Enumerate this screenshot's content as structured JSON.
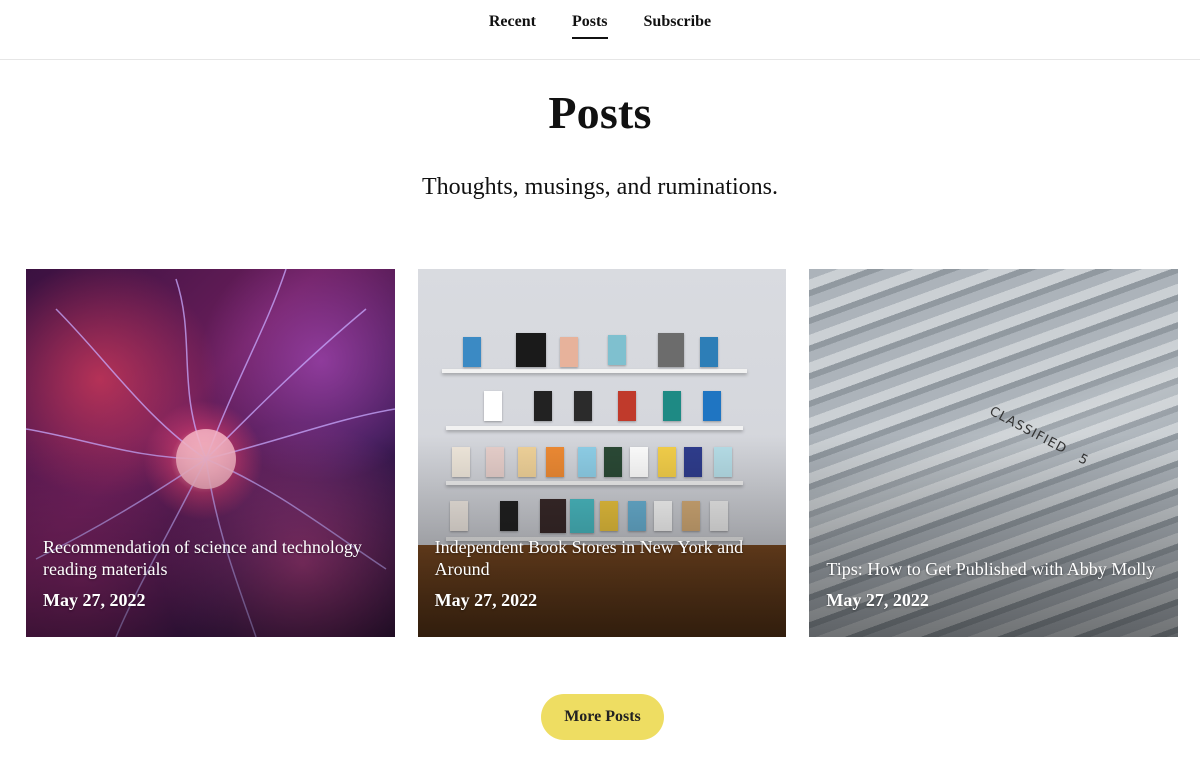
{
  "nav": {
    "items": [
      {
        "label": "Recent",
        "active": false
      },
      {
        "label": "Posts",
        "active": true
      },
      {
        "label": "Subscribe",
        "active": false
      }
    ]
  },
  "header": {
    "title": "Posts",
    "subtitle": "Thoughts, musings, and ruminations."
  },
  "posts": [
    {
      "title": "Recommendation of science and technology reading materials",
      "date": "May 27, 2022",
      "image": "plasma-ball"
    },
    {
      "title": "Independent Book Stores in New York and Around",
      "date": "May 27, 2022",
      "image": "bookstore-shelves"
    },
    {
      "title": "Tips: How to Get Published with Abby Molly",
      "date": "May 27, 2022",
      "image": "classified-files"
    }
  ],
  "more_button": {
    "label": "More Posts",
    "color": "#eedd62"
  }
}
